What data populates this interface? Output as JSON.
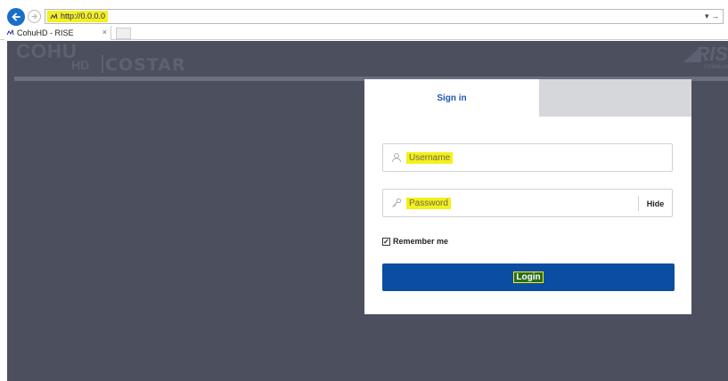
{
  "browser": {
    "address": "http://0.0.0.0",
    "tab_title": "CohuHD - RISE",
    "tab_close": "×",
    "address_dropdown": "▾ →"
  },
  "branding": {
    "cohu": "COHU",
    "hd": "HD",
    "costar": "COSTAR",
    "rise": "RIS",
    "rise_sub": "COMMAN"
  },
  "login": {
    "tab_signin": "Sign in",
    "username_placeholder": "Username",
    "password_placeholder": "Password",
    "hide_label": "Hide",
    "remember_label": "Remember me",
    "remember_checked": true,
    "login_label": "Login"
  },
  "colors": {
    "accent": "#0b4da3",
    "background": "#4c4f5d",
    "highlight": "#f4f01c"
  }
}
